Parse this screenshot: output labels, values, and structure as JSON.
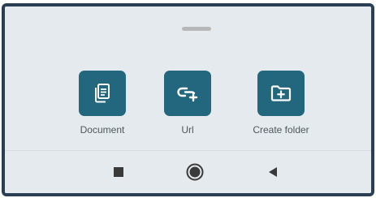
{
  "sheet": {
    "actions": [
      {
        "label": "Document",
        "icon": "document-icon"
      },
      {
        "label": "Url",
        "icon": "link-add-icon"
      },
      {
        "label": "Create folder",
        "icon": "folder-add-icon"
      }
    ]
  },
  "nav_bar": {
    "buttons": [
      {
        "icon": "recents-square-icon"
      },
      {
        "icon": "home-circle-icon"
      },
      {
        "icon": "back-triangle-icon"
      }
    ]
  },
  "colors": {
    "tile": "#22677d",
    "background": "#e4eaee",
    "frame": "#2a3f53",
    "label": "#4f575c",
    "nav_icon": "#3a3a3a"
  }
}
